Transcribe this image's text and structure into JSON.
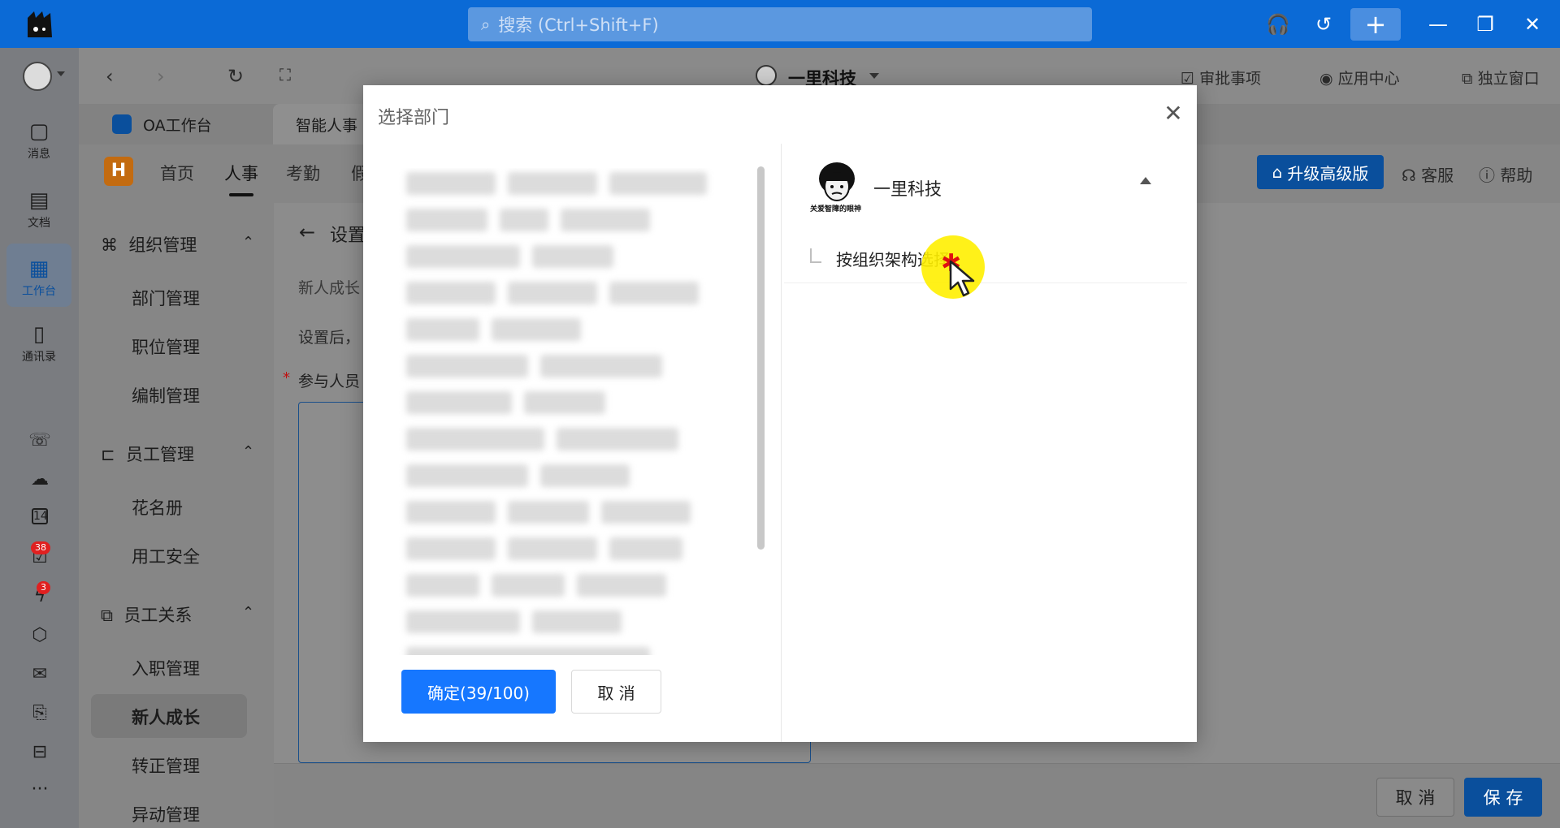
{
  "titlebar": {
    "search_placeholder": "搜索 (Ctrl+Shift+F)",
    "icons": [
      "headset-icon",
      "history-icon",
      "plus-icon",
      "minimize-icon",
      "restore-icon",
      "close-icon"
    ]
  },
  "rail": {
    "items": [
      {
        "label": "消息",
        "icon": "message-icon"
      },
      {
        "label": "文档",
        "icon": "document-icon"
      },
      {
        "label": "工作台",
        "icon": "workbench-icon"
      },
      {
        "label": "通讯录",
        "icon": "contacts-icon"
      }
    ],
    "badges": {
      "todo": "38",
      "flash": "3"
    }
  },
  "nav": {
    "org": "一里科技",
    "links": [
      "审批事项",
      "应用中心",
      "独立窗口"
    ]
  },
  "tabs": [
    "OA工作台",
    "智能人事"
  ],
  "appnav": [
    "首页",
    "人事",
    "考勤",
    "假"
  ],
  "app_actions": {
    "upgrade": "升级高级版",
    "service": "客服",
    "help": "帮助"
  },
  "sidebar": {
    "groups": [
      {
        "label": "组织管理",
        "items": [
          "部门管理",
          "职位管理",
          "编制管理"
        ]
      },
      {
        "label": "员工管理",
        "items": [
          "花名册",
          "用工安全"
        ]
      },
      {
        "label": "员工关系",
        "items": [
          "入职管理",
          "新人成长",
          "转正管理",
          "异动管理"
        ]
      }
    ]
  },
  "content": {
    "page_title": "设置",
    "subtitle": "新人成长",
    "desc": "设置后，",
    "required_label": "参与人员"
  },
  "footer": {
    "cancel": "取 消",
    "save": "保 存"
  },
  "modal": {
    "title": "选择部门",
    "confirm": "确定(39/100)",
    "cancel": "取 消",
    "org_name": "一里科技",
    "org_avatar_caption": "关爱智障的眼神",
    "child": "按组织架构选择"
  }
}
